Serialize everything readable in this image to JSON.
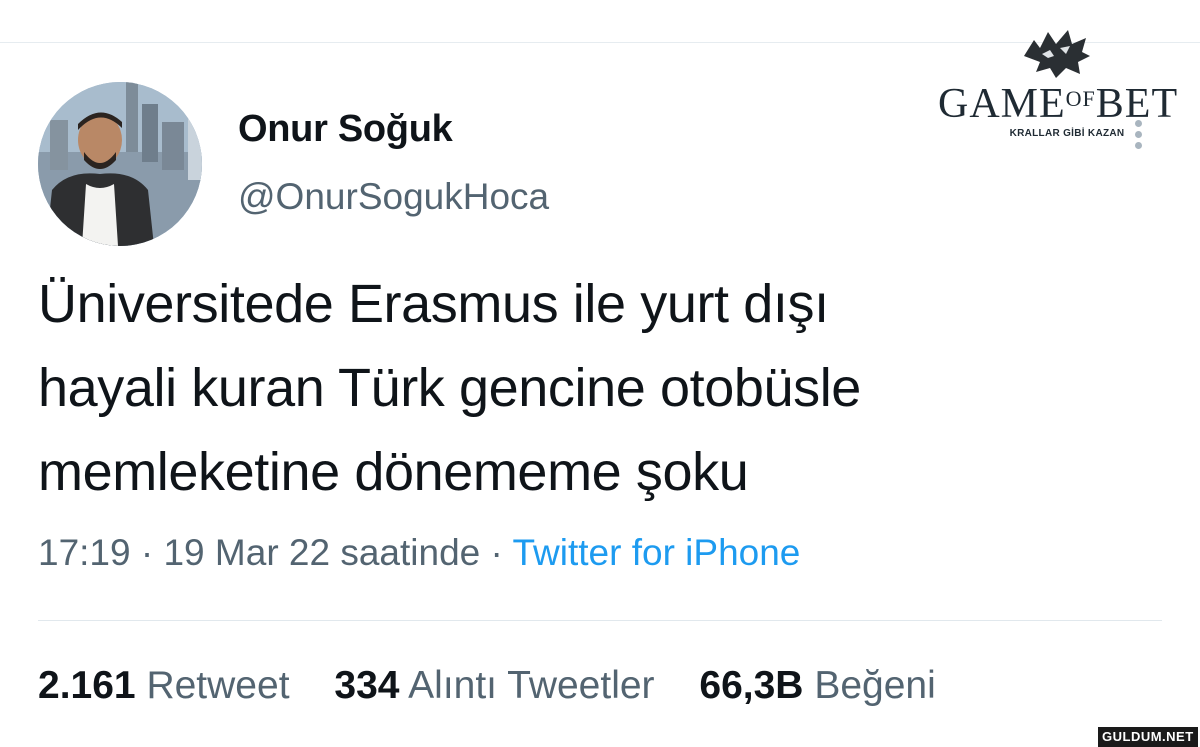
{
  "author": {
    "display_name": "Onur Soğuk",
    "handle": "@OnurSogukHoca"
  },
  "brand": {
    "name_part1": "GAME",
    "name_part2": "OF",
    "name_part3": "BET",
    "tagline": "KRALLAR GİBİ KAZAN",
    "icon": "wolf-head-logo"
  },
  "tweet": {
    "lines": [
      "Üniversitede Erasmus ile yurt dışı",
      "hayali kuran Türk gencine otobüsle",
      "memleketine dönememe şoku"
    ]
  },
  "meta": {
    "time": "17:19",
    "separator": " · ",
    "date": "19 Mar 22 saatinde",
    "source": "Twitter for iPhone"
  },
  "stats": [
    {
      "value": "2.161",
      "label": "Retweet"
    },
    {
      "value": "334",
      "label": "Alıntı Tweetler"
    },
    {
      "value": "66,3B",
      "label": "Beğeni"
    }
  ],
  "watermark": "GULDUM.NET",
  "colors": {
    "text": "#0f1419",
    "secondary": "#536471",
    "link": "#1d9bf0",
    "divider": "#e1e8ed"
  }
}
